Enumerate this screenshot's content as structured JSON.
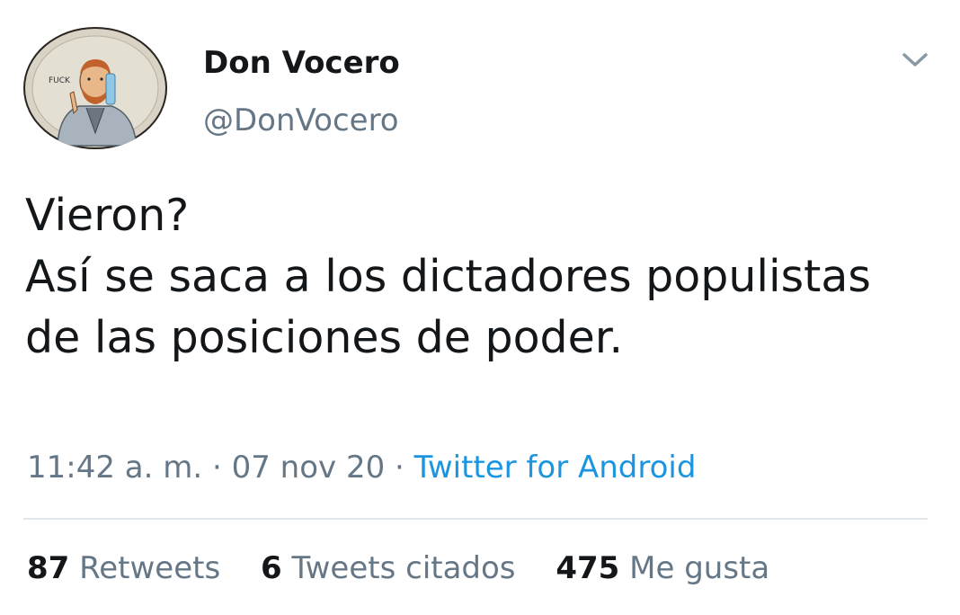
{
  "user": {
    "display_name": "Don Vocero",
    "handle": "@DonVocero",
    "avatar_label": "FUCK"
  },
  "tweet": {
    "text": "Vieron?\nAsí se saca a los dictadores populistas de las posiciones de poder.",
    "time": "11:42 a. m.",
    "separator": " · ",
    "date": "07 nov 20",
    "source": "Twitter for Android"
  },
  "stats": {
    "retweets_count": "87",
    "retweets_label": "Retweets",
    "quotes_count": "6",
    "quotes_label": "Tweets citados",
    "likes_count": "475",
    "likes_label": "Me gusta"
  },
  "icons": {
    "menu": "chevron-down-icon"
  },
  "colors": {
    "text": "#14171a",
    "secondary": "#657786",
    "link": "#1b95e0",
    "divider": "#e1e8ed"
  }
}
